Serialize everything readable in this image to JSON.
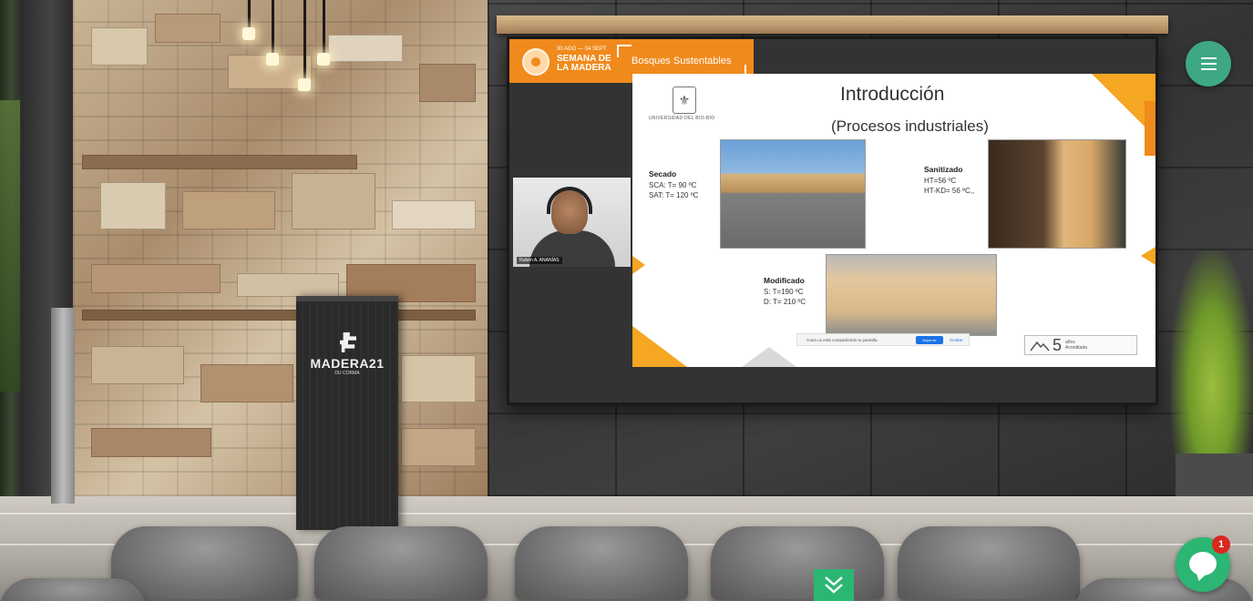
{
  "brand": {
    "dates": "30 AGO — 04 SEPT",
    "name": "SEMANA DE LA MADERA",
    "session_title": "Bosques Sustentables",
    "logo_icon": "semana-madera-logo-icon"
  },
  "webcam": {
    "speaker_name": "Rubén A. ANANÍAS"
  },
  "slide": {
    "university_name": "UNIVERSIDAD DEL BÍO-BÍO",
    "title": "Introducción",
    "subtitle": "(Procesos industriales)",
    "secado": {
      "heading": "Secado",
      "line1": "SCA: T= 90 ºC",
      "line2": "SAT: T= 120 ºC"
    },
    "sanitizado": {
      "heading": "Sanitizado",
      "line1": "HT=56 ºC",
      "line2": "HT-KD= 56 ºC,,"
    },
    "modificado": {
      "heading": "Modificado",
      "line1": "S: T=190 ºC",
      "line2": "D: T= 210 ºC"
    },
    "accreditation": {
      "number": "5",
      "text": "años\nAcreditada"
    }
  },
  "share_bar": {
    "message": "zoom.us está compartiendo tu pantalla.",
    "stop_label": "Dejar de compartir",
    "hide_label": "Ocultar"
  },
  "podium": {
    "name": "MADERA21",
    "sub": "DU CORMA",
    "logo_icon": "madera21-logo-icon"
  },
  "controls": {
    "menu_icon": "hamburger-menu-icon",
    "chat_icon": "chat-bubble-icon",
    "chat_unread": "1",
    "scroll_icon": "chevron-double-down-icon"
  },
  "colors": {
    "brand_orange": "#f08a1c",
    "accent_green": "#3ea883",
    "chat_green": "#2cb673",
    "badge_red": "#d9281e"
  }
}
